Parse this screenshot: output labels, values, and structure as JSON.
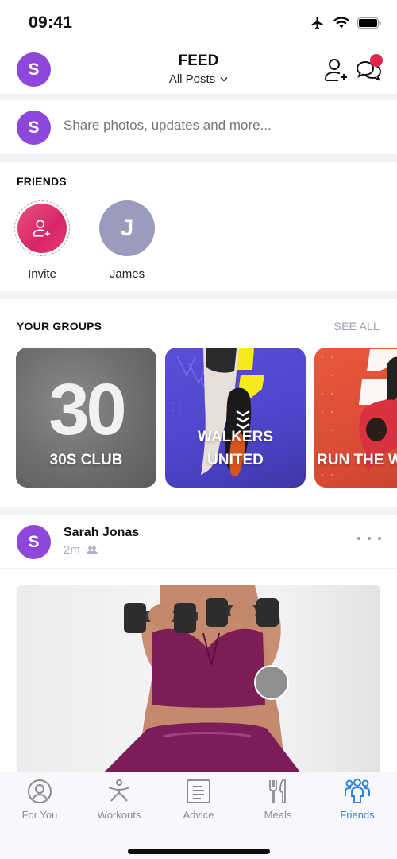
{
  "status_bar": {
    "time": "09:41",
    "icons": [
      "airplane-icon",
      "wifi-icon",
      "battery-icon"
    ]
  },
  "header": {
    "avatar_initial": "S",
    "title": "FEED",
    "filter_label": "All Posts",
    "icons": [
      "add-friend-icon",
      "messages-icon"
    ],
    "has_notification": true
  },
  "composer": {
    "avatar_initial": "S",
    "placeholder": "Share photos, updates and more..."
  },
  "friends": {
    "title": "FRIENDS",
    "items": [
      {
        "name": "Invite",
        "type": "invite",
        "icon": "add-friend-icon"
      },
      {
        "name": "James",
        "type": "friend",
        "initial": "J"
      }
    ]
  },
  "groups": {
    "title": "YOUR GROUPS",
    "see_all_label": "SEE ALL",
    "items": [
      {
        "name": "30S CLUB",
        "badge": "30"
      },
      {
        "name_line1": "WALKERS",
        "name_line2": "UNITED"
      },
      {
        "name": "RUN THE W"
      }
    ]
  },
  "post": {
    "avatar_initial": "S",
    "author": "Sarah Jonas",
    "time": "2m",
    "audience_icon": "friends-icon",
    "more_icon": "more-icon",
    "image_alt": "Woman in purple workout outfit holding dumbbells"
  },
  "tabbar": {
    "tabs": [
      {
        "label": "For You",
        "icon": "for-you-icon",
        "active": false
      },
      {
        "label": "Workouts",
        "icon": "workouts-icon",
        "active": false
      },
      {
        "label": "Advice",
        "icon": "advice-icon",
        "active": false
      },
      {
        "label": "Meals",
        "icon": "meals-icon",
        "active": false
      },
      {
        "label": "Friends",
        "icon": "friends-icon",
        "active": true
      }
    ]
  },
  "colors": {
    "avatar_purple": "#8f47db",
    "notification_red": "#e0274f",
    "active_tab_blue": "#2d86d8",
    "invite_pink": "#d6266b",
    "james_avatar": "#9d9bbd"
  }
}
